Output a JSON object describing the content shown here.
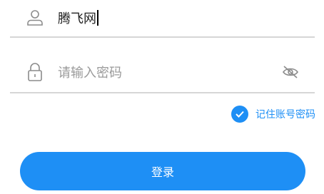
{
  "login_form": {
    "username": {
      "value": "腾飞网",
      "icon": "user-icon"
    },
    "password": {
      "value": "",
      "placeholder": "请输入密码",
      "icon": "lock-icon",
      "toggle_icon": "eye-off-icon"
    },
    "remember": {
      "label": "记住账号密码",
      "checked": true,
      "icon": "checkmark-icon"
    },
    "submit_label": "登录"
  },
  "colors": {
    "accent": "#1e8ff5",
    "divider": "#d6d6d6",
    "placeholder": "#9a9a9a",
    "icon": "#8c8c8c"
  }
}
